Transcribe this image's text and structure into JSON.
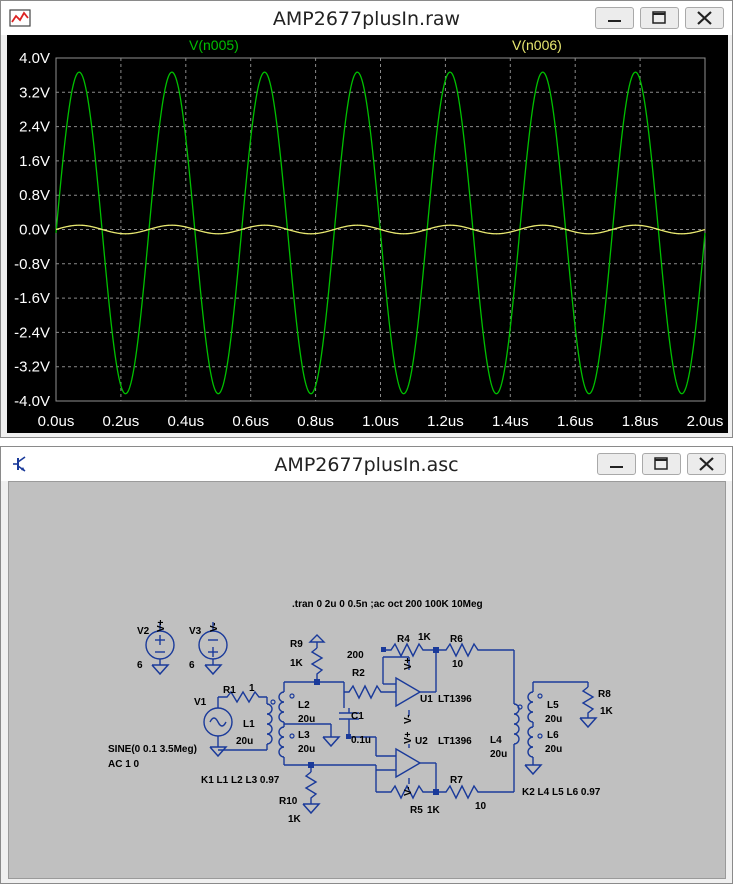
{
  "plot_window": {
    "title": "AMP2677plusIn.raw",
    "icon": "waveform-icon",
    "trace_labels": [
      "V(n005)",
      "V(n006)"
    ],
    "trace_colors": [
      "#00c000",
      "#e8e870"
    ]
  },
  "schematic_window": {
    "title": "AMP2677plusIn.asc",
    "icon": "transistor-icon",
    "directive": ".tran 0 2u 0 0.5n ;ac oct 200 100K 10Meg",
    "source_spec": "SINE(0 0.1 3.5Meg)",
    "ac_spec": "AC 1 0",
    "coupling1": "K1 L1 L2 L3 0.97",
    "coupling2": "K2 L4 L5 L6 0.97",
    "labels": {
      "v2": "V2",
      "v2_val": "6",
      "v3": "V3",
      "v3_val": "6",
      "vplus_a": "V+",
      "vminus_a": "V-",
      "v1": "V1",
      "r1": "R1",
      "r1_val": "1",
      "l1": "L1",
      "l1_val": "20u",
      "r9": "R9",
      "r9_val": "1K",
      "l2": "L2",
      "l2_val": "20u",
      "l3": "L3",
      "l3_val": "20u",
      "r10": "R10",
      "r10_val": "1K",
      "r2": "R2",
      "r2_val": "200",
      "c1": "C1",
      "c1_val": "0.1u",
      "r4": "R4",
      "r4_val": "1K",
      "r6": "R6",
      "r6_val": "10",
      "u1": "U1",
      "u1_model": "LT1396",
      "u2": "U2",
      "u2_model": "LT1396",
      "r5": "R5",
      "r5_val": "1K",
      "r7": "R7",
      "r7_val": "10",
      "l4": "L4",
      "l4_val": "20u",
      "l5": "L5",
      "l5_val": "20u",
      "l6": "L6",
      "l6_val": "20u",
      "r8": "R8",
      "r8_val": "1K",
      "vp": "V+",
      "vm": "V-"
    }
  },
  "chart_data": {
    "type": "line",
    "title": "",
    "xlabel": "",
    "ylabel": "",
    "xlim": [
      0,
      2
    ],
    "ylim": [
      -4,
      4
    ],
    "x_unit": "us",
    "y_unit": "V",
    "x_ticks": [
      "0.0us",
      "0.2us",
      "0.4us",
      "0.6us",
      "0.8us",
      "1.0us",
      "1.2us",
      "1.4us",
      "1.6us",
      "1.8us",
      "2.0us"
    ],
    "y_ticks": [
      "4.0V",
      "3.2V",
      "2.4V",
      "1.6V",
      "0.8V",
      "0.0V",
      "-0.8V",
      "-1.6V",
      "-2.4V",
      "-3.2V",
      "-4.0V"
    ],
    "grid": true,
    "series": [
      {
        "name": "V(n005)",
        "waveform": "sine",
        "frequency_mhz": 3.5,
        "amplitude_v": 3.75,
        "offset_v": -0.08
      },
      {
        "name": "V(n006)",
        "waveform": "sine",
        "frequency_mhz": 3.5,
        "amplitude_v": 0.1,
        "offset_v": 0.0
      }
    ]
  }
}
